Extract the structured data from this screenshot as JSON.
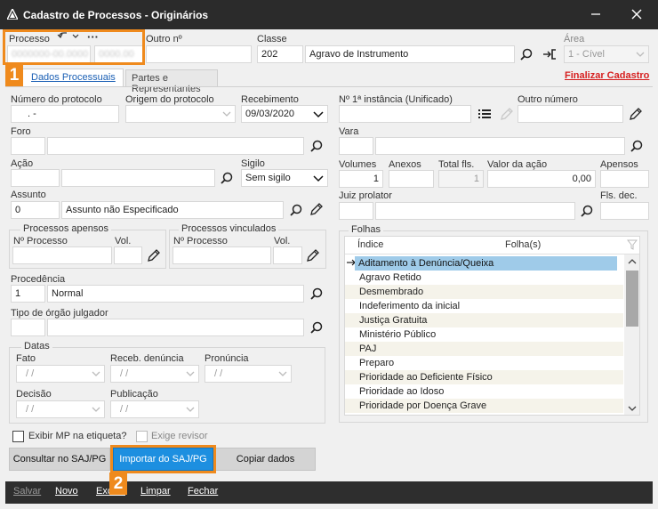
{
  "window": {
    "title": "Cadastro de Processos - Originários"
  },
  "header": {
    "processo_label": "Processo",
    "outro_label": "Outro nº",
    "classe_label": "Classe",
    "classe_code": "202",
    "classe_name": "Agravo de Instrumento",
    "area_label": "Área",
    "area_value": "1 - Cível",
    "processo_value": "0000000-00.0000",
    "outro_value": "0000.00"
  },
  "tabs": [
    {
      "label": "Dados Processuais"
    },
    {
      "label": "Partes e Representantes"
    }
  ],
  "finalizar_label": "Finalizar Cadastro",
  "left": {
    "num_protocolo_label": "Número do protocolo",
    "num_protocolo_value": ".        -",
    "origem_label": "Origem do protocolo",
    "recebimento_label": "Recebimento",
    "recebimento_value": "09/03/2020",
    "foro_label": "Foro",
    "acao_label": "Ação",
    "sigilo_label": "Sigilo",
    "sigilo_value": "Sem sigilo",
    "assunto_label": "Assunto",
    "assunto_code": "0",
    "assunto_name": "Assunto não Especificado",
    "proc_apensos_title": "Processos apensos",
    "proc_vinculados_title": "Processos vinculados",
    "nproc_label": "Nº Processo",
    "vol_label": "Vol.",
    "procedencia_label": "Procedência",
    "procedencia_code": "1",
    "procedencia_name": "Normal",
    "tipo_orgao_label": "Tipo de órgão julgador",
    "datas_title": "Datas",
    "fato_label": "Fato",
    "receb_denuncia_label": "Receb. denúncia",
    "pronuncia_label": "Pronúncia",
    "decisao_label": "Decisão",
    "publicacao_label": "Publicação",
    "date_placeholder": "/ /",
    "exibir_mp_label": "Exibir MP na etiqueta?",
    "exige_revisor_label": "Exige revisor"
  },
  "right": {
    "n_instancia_label": "Nº 1ª instância (Unificado)",
    "outro_numero_label": "Outro número",
    "vara_label": "Vara",
    "volumes_label": "Volumes",
    "volumes_value": "1",
    "anexos_label": "Anexos",
    "total_fls_label": "Total fls.",
    "total_fls_value": "1",
    "valor_acao_label": "Valor da ação",
    "valor_acao_value": "0,00",
    "apensos_label": "Apensos",
    "juiz_label": "Juiz prolator",
    "fls_dec_label": "Fls. dec.",
    "folhas_title": "Folhas",
    "folhas_col_indice": "Índice",
    "folhas_col_folhas": "Folha(s)",
    "folhas_items": [
      "Aditamento à Denúncia/Queixa",
      "Agravo Retido",
      "Desmembrado",
      "Indeferimento da inicial",
      "Justiça Gratuita",
      "Ministério Público",
      "PAJ",
      "Preparo",
      "Prioridade ao Deficiente Físico",
      "Prioridade ao Idoso",
      "Prioridade por Doença Grave"
    ]
  },
  "buttons": {
    "consultar": "Consultar no SAJ/PG",
    "importar": "Importar do SAJ/PG",
    "copiar": "Copiar dados"
  },
  "footer": {
    "salvar": "Salvar",
    "novo": "Novo",
    "excluir": "Excluir",
    "limpar": "Limpar",
    "fechar": "Fechar"
  },
  "badges": {
    "one": "1",
    "two": "2"
  },
  "colors": {
    "accent": "#ef8a1d",
    "primary": "#1d8fe0",
    "link_red": "#d62020",
    "titlebar": "#2b2b2b"
  }
}
